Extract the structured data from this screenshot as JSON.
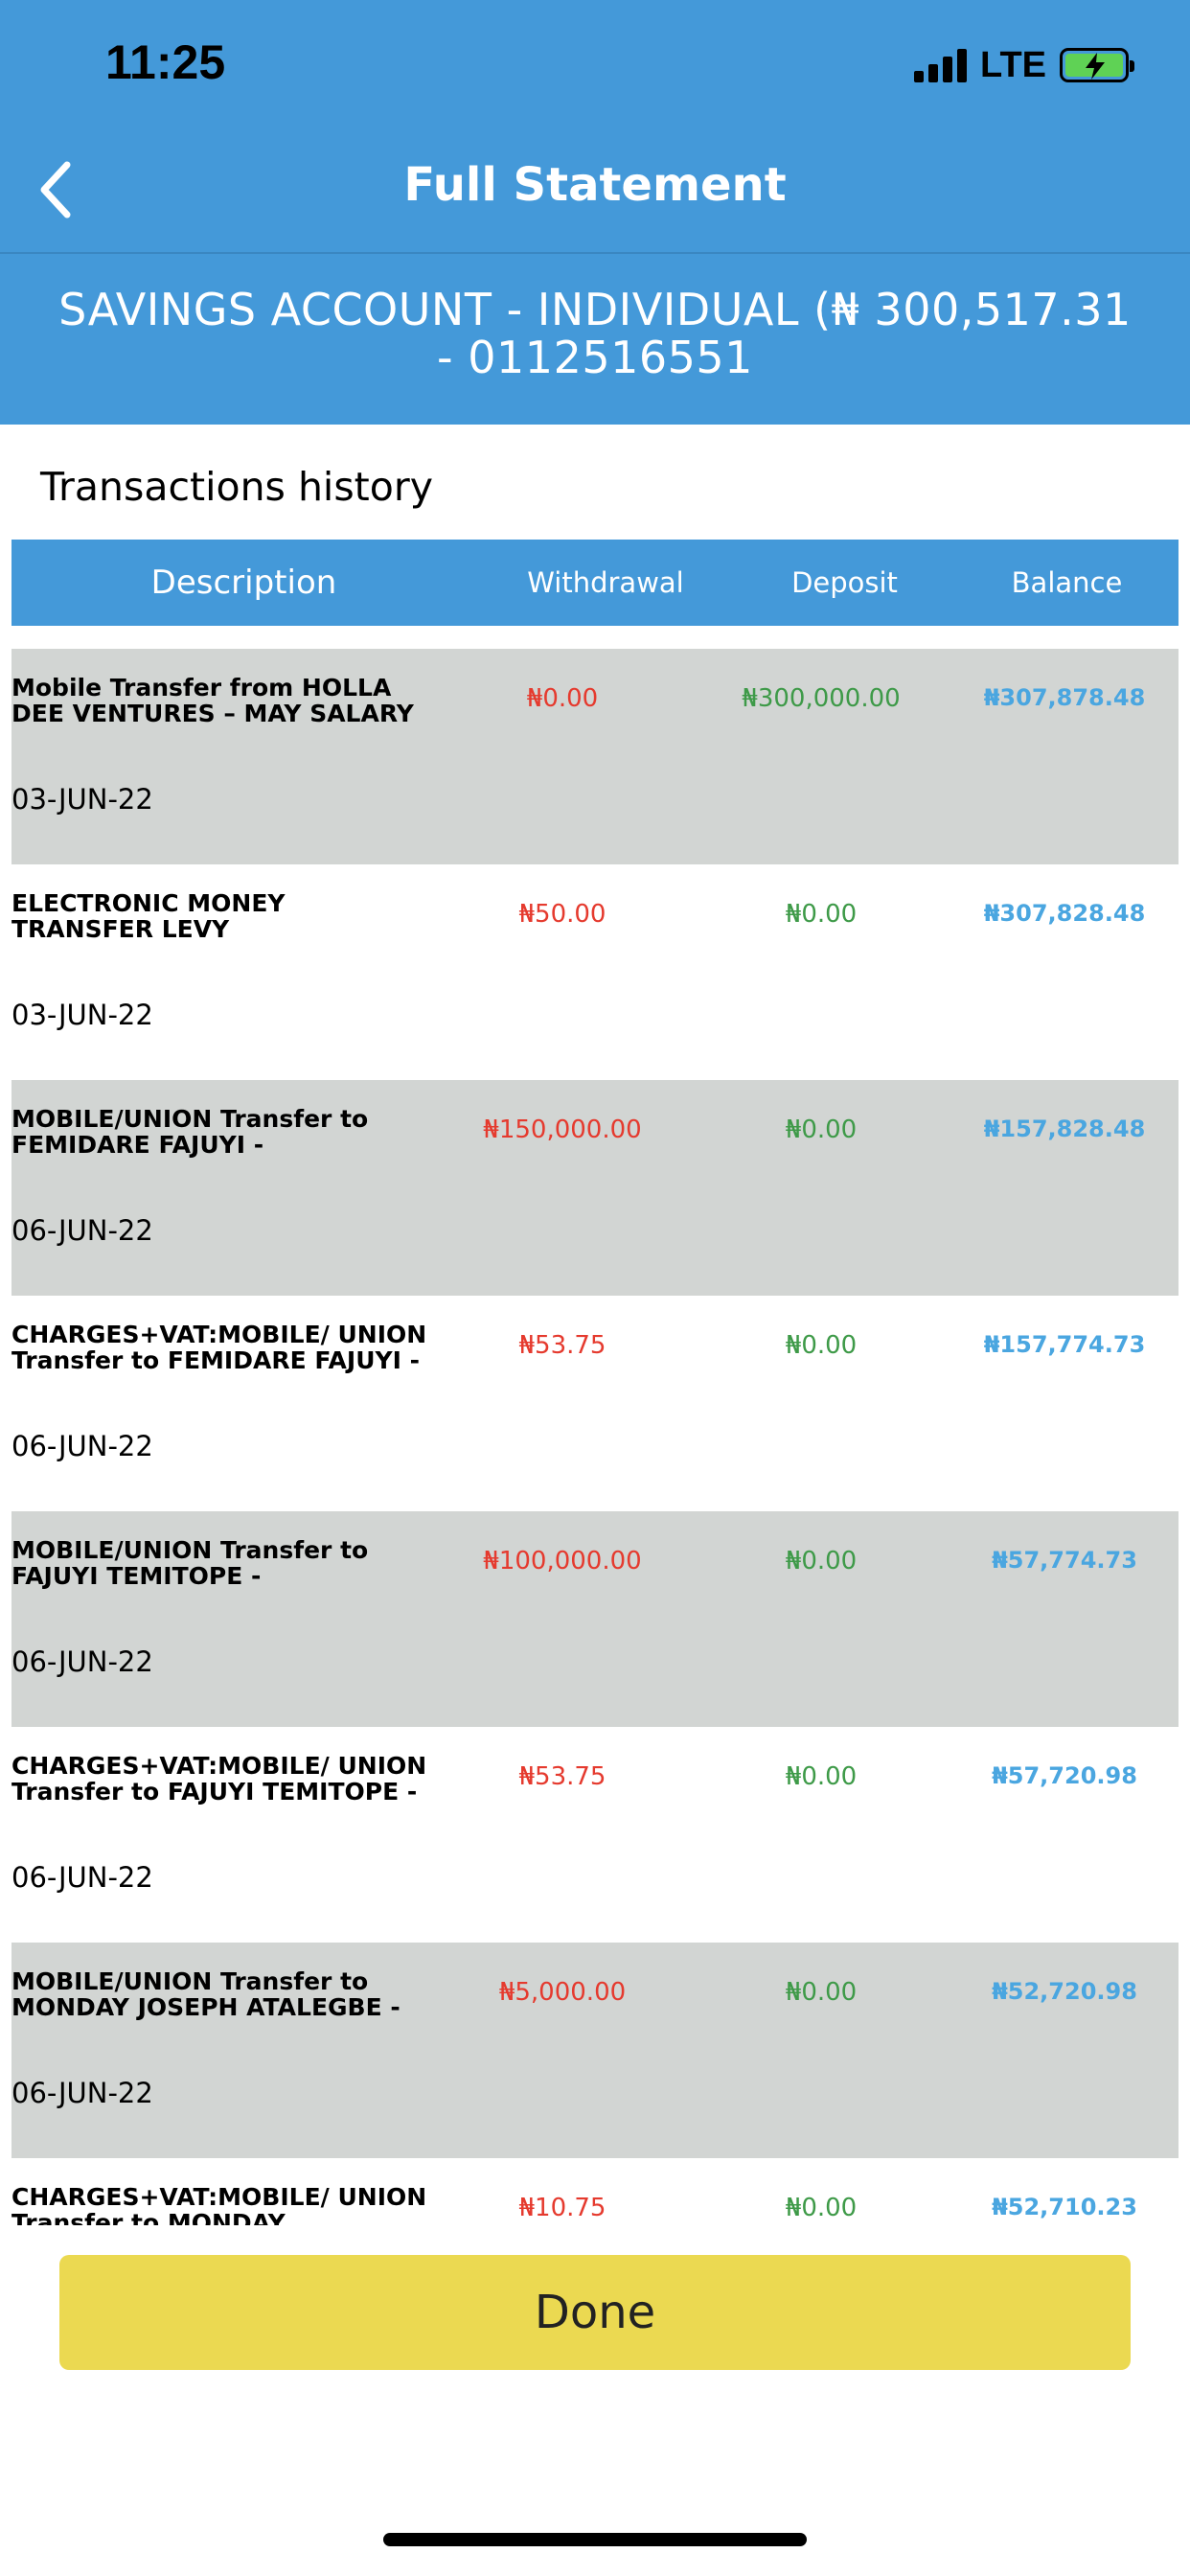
{
  "status_bar": {
    "time": "11:25",
    "network": "LTE"
  },
  "nav": {
    "title": "Full Statement",
    "back_icon": "chevron-left-icon"
  },
  "account": {
    "line1": "SAVINGS ACCOUNT - INDIVIDUAL (₦ 300,517.31",
    "line2": "- 0112516551"
  },
  "section_title": "Transactions history",
  "table": {
    "headers": {
      "description": "Description",
      "withdrawal": "Withdrawal",
      "deposit": "Deposit",
      "balance": "Balance"
    },
    "rows": [
      {
        "description": "Mobile Transfer from HOLLA DEE VENTURES – MAY SALARY",
        "date": "03-JUN-22",
        "withdrawal": "₦0.00",
        "deposit": "₦300,000.00",
        "balance": "₦307,878.48"
      },
      {
        "description": "ELECTRONIC MONEY TRANSFER LEVY",
        "date": "03-JUN-22",
        "withdrawal": "₦50.00",
        "deposit": "₦0.00",
        "balance": "₦307,828.48"
      },
      {
        "description": "MOBILE/UNION Transfer to FEMIDARE FAJUYI -",
        "date": "06-JUN-22",
        "withdrawal": "₦150,000.00",
        "deposit": "₦0.00",
        "balance": "₦157,828.48"
      },
      {
        "description": "CHARGES+VAT:MOBILE/ UNION Transfer to FEMIDARE FAJUYI -",
        "date": "06-JUN-22",
        "withdrawal": "₦53.75",
        "deposit": "₦0.00",
        "balance": "₦157,774.73"
      },
      {
        "description": "MOBILE/UNION Transfer to FAJUYI TEMITOPE -",
        "date": "06-JUN-22",
        "withdrawal": "₦100,000.00",
        "deposit": "₦0.00",
        "balance": "₦57,774.73"
      },
      {
        "description": "CHARGES+VAT:MOBILE/ UNION Transfer to FAJUYI TEMITOPE -",
        "date": "06-JUN-22",
        "withdrawal": "₦53.75",
        "deposit": "₦0.00",
        "balance": "₦57,720.98"
      },
      {
        "description": "MOBILE/UNION Transfer to MONDAY JOSEPH ATALEGBE -",
        "date": "06-JUN-22",
        "withdrawal": "₦5,000.00",
        "deposit": "₦0.00",
        "balance": "₦52,720.98"
      },
      {
        "description": "CHARGES+VAT:MOBILE/ UNION Transfer to MONDAY",
        "date": "",
        "withdrawal": "₦10.75",
        "deposit": "₦0.00",
        "balance": "₦52,710.23"
      }
    ]
  },
  "done_button": "Done",
  "colors": {
    "primary": "#4499d9",
    "row_shade": "#d2d5d3",
    "withdrawal": "#e53a2e",
    "deposit": "#3e9a48",
    "balance": "#4aa6e0",
    "done": "#ebd951"
  }
}
